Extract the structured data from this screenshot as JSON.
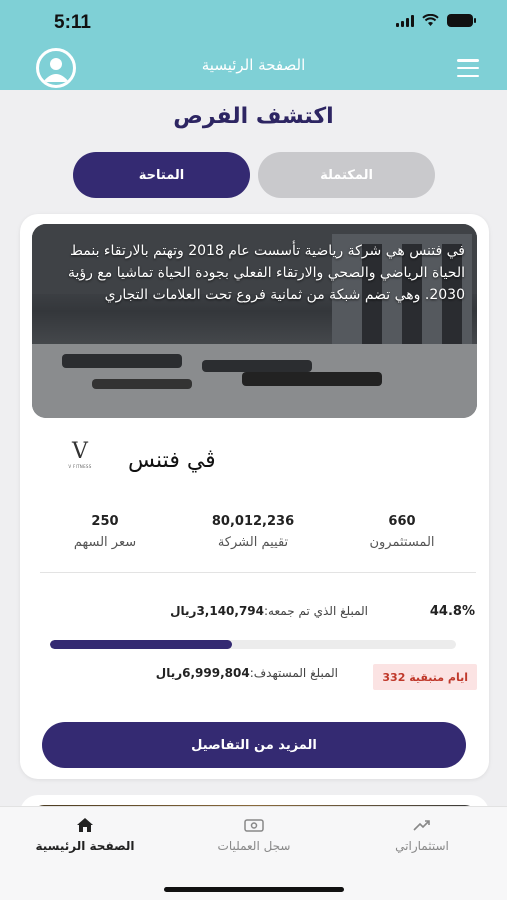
{
  "status_bar": {
    "time": "5:11"
  },
  "header": {
    "title": "الصفحة الرئيسية"
  },
  "page": {
    "title": "اكتشف الفرص"
  },
  "tabs": [
    {
      "label": "المتاحة",
      "active": true
    },
    {
      "label": "المكتملة",
      "active": false
    }
  ],
  "opportunity": {
    "description": "في فتنس هي شركة رياضية تأسست عام 2018 وتهتم بالارتقاء بنمط الحياة الرياضي والصحي والارتقاء الفعلي بجودة الحياة تماشيا مع رؤية 2030. وهي تضم شبكة من ثمانية فروع تحت العلامات التجاري",
    "logo_letter": "V",
    "logo_caption": "V FITNESS",
    "company_name": "ڤي فتنس",
    "stats": {
      "investors": {
        "value": "660",
        "label": "المستثمرون"
      },
      "valuation": {
        "value": "80,012,236",
        "label": "تقييم الشركة"
      },
      "share_price": {
        "value": "250",
        "label": "سعر السهم"
      }
    },
    "percent_label": "44.8%",
    "progress_fraction": 0.448,
    "raised_label": "المبلغ الذي تم جمعه:",
    "raised_amount": "3,140,794ريال",
    "target_label": "المبلغ المستهدف:",
    "target_amount": "6,999,804ريال",
    "days_left": "332 ايام متبقية",
    "details_button": "المزيد من التفاصيل"
  },
  "bottom_nav": [
    {
      "label": "الصفحة الرئيسية",
      "icon": "home-icon",
      "active": true
    },
    {
      "label": "سجل العمليات",
      "icon": "transactions-icon",
      "active": false
    },
    {
      "label": "استثماراتي",
      "icon": "investments-icon",
      "active": false
    }
  ],
  "colors": {
    "header": "#7fd0d6",
    "primary": "#342a72",
    "inactive_tab": "#c9c9cc",
    "badge_bg": "#fbe3e3",
    "badge_text": "#c0392b"
  }
}
